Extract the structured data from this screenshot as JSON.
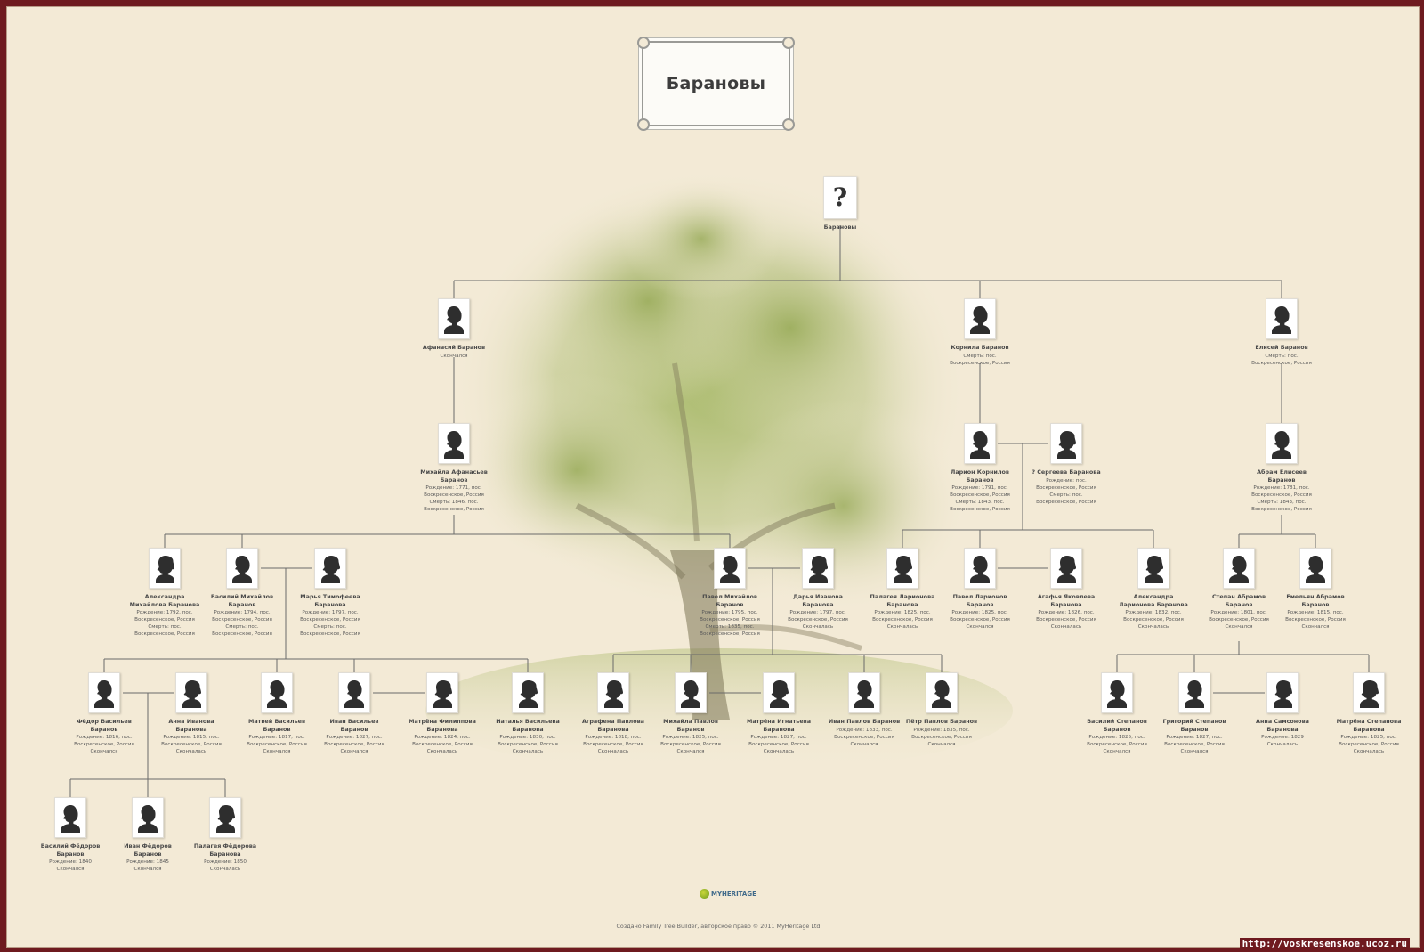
{
  "title": "Барановы",
  "footer": {
    "brand": "MYHERITAGE",
    "credit": "Создано Family Tree Builder, авторское право © 2011 MyHeritage Ltd."
  },
  "watermark_url": "http://voskresenskoe.ucoz.ru",
  "colors": {
    "frame": "#6e1a1f",
    "background": "#f3ead6",
    "line": "#6a6a6a",
    "tree": "#8aa248"
  },
  "people": [
    {
      "id": "root",
      "icon": "question-mark",
      "name": "Барановы",
      "info": ""
    },
    {
      "id": "afanasy",
      "icon": "male-silhouette-icon",
      "name": "Афанасий Баранов",
      "info": "Скончался"
    },
    {
      "id": "kornila",
      "icon": "male-silhouette-icon",
      "name": "Корнила Баранов",
      "info": "Смерть: пос.\nВоскресенское, Россия"
    },
    {
      "id": "eliseу",
      "icon": "male-silhouette-icon",
      "name": "Елисей Баранов",
      "info": "Смерть: пос.\nВоскресенское, Россия"
    },
    {
      "id": "mikhaila_af",
      "icon": "male-silhouette-icon",
      "name": "Михайла Афанасьев\nБаранов",
      "info": "Рождение: 1771, пос.\nВоскресенское, Россия\nСмерть: 1846, пос.\nВоскресенское, Россия"
    },
    {
      "id": "larion",
      "icon": "male-silhouette-icon",
      "name": "Ларион Корнилов\nБаранов",
      "info": "Рождение: 1791, пос.\nВоскресенское, Россия\nСмерть: 1843, пос.\nВоскресенское, Россия"
    },
    {
      "id": "sergeeva",
      "icon": "female-silhouette-icon",
      "name": "? Сергеева Баранова",
      "info": "Рождение: пос.\nВоскресенское, Россия\nСмерть: пос.\nВоскресенское, Россия"
    },
    {
      "id": "abram",
      "icon": "male-silhouette-icon",
      "name": "Абрам Елисеев\nБаранов",
      "info": "Рождение: 1781, пос.\nВоскресенское, Россия\nСмерть: 1843, пос.\nВоскресенское, Россия"
    },
    {
      "id": "aleksandra_m",
      "icon": "female-silhouette-icon",
      "name": "Александра\nМихайлова Баранова",
      "info": "Рождение: 1792, пос.\nВоскресенское, Россия\nСмерть: пос.\nВоскресенское, Россия"
    },
    {
      "id": "vasily_m",
      "icon": "male-silhouette-icon",
      "name": "Василий Михайлов\nБаранов",
      "info": "Рождение: 1794, пос.\nВоскресенское, Россия\nСмерть: пос.\nВоскресенское, Россия"
    },
    {
      "id": "marya",
      "icon": "female-silhouette-icon",
      "name": "Марья Тимофеева\nБаранова",
      "info": "Рождение: 1797, пос.\nВоскресенское, Россия\nСмерть: пос.\nВоскресенское, Россия"
    },
    {
      "id": "pavel_m",
      "icon": "male-silhouette-icon",
      "name": "Павел Михайлов\nБаранов",
      "info": "Рождение: 1795, пос.\nВоскресенское, Россия\nСмерть: 1835, пос.\nВоскресенское, Россия"
    },
    {
      "id": "darya",
      "icon": "female-silhouette-icon",
      "name": "Дарья Иванова\nБаранова",
      "info": "Рождение: 1797, пос.\nВоскресенское, Россия\nСкончалась"
    },
    {
      "id": "palageya_l",
      "icon": "female-silhouette-icon",
      "name": "Палагея Ларионова\nБаранова",
      "info": "Рождение: 1825, пос.\nВоскресенское, Россия\nСкончалась"
    },
    {
      "id": "pavel_l",
      "icon": "male-silhouette-icon",
      "name": "Павел Ларионов\nБаранов",
      "info": "Рождение: 1825, пос.\nВоскресенское, Россия\nСкончался"
    },
    {
      "id": "agafya",
      "icon": "female-silhouette-icon",
      "name": "Агафья Яковлева\nБаранова",
      "info": "Рождение: 1826, пос.\nВоскресенское, Россия\nСкончалась"
    },
    {
      "id": "aleksandra_l",
      "icon": "female-silhouette-icon",
      "name": "Александра\nЛарионова Баранова",
      "info": "Рождение: 1832, пос.\nВоскресенское, Россия\nСкончалась"
    },
    {
      "id": "stepan",
      "icon": "male-silhouette-icon",
      "name": "Степан Абрамов\nБаранов",
      "info": "Рождение: 1801, пос.\nВоскресенское, Россия\nСкончался"
    },
    {
      "id": "emelyan",
      "icon": "male-silhouette-icon",
      "name": "Емельян Абрамов\nБаранов",
      "info": "Рождение: 1815, пос.\nВоскресенское, Россия\nСкончался"
    },
    {
      "id": "fedor",
      "icon": "male-silhouette-icon",
      "name": "Фёдор Васильев\nБаранов",
      "info": "Рождение: 1816, пос.\nВоскресенское, Россия\nСкончался"
    },
    {
      "id": "anna_i",
      "icon": "female-silhouette-icon",
      "name": "Анна Иванова\nБаранова",
      "info": "Рождение: 1815, пос.\nВоскресенское, Россия\nСкончалась"
    },
    {
      "id": "matvey",
      "icon": "male-silhouette-icon",
      "name": "Матвей Васильев\nБаранов",
      "info": "Рождение: 1817, пос.\nВоскресенское, Россия\nСкончался"
    },
    {
      "id": "ivan_v",
      "icon": "male-silhouette-icon",
      "name": "Иван Васильев\nБаранов",
      "info": "Рождение: 1827, пос.\nВоскресенское, Россия\nСкончался"
    },
    {
      "id": "matrena_f",
      "icon": "female-silhouette-icon",
      "name": "Матрёна Филиппова\nБаранова",
      "info": "Рождение: 1824, пос.\nВоскресенское, Россия\nСкончалась"
    },
    {
      "id": "natalya",
      "icon": "female-silhouette-icon",
      "name": "Наталья Васильева\nБаранова",
      "info": "Рождение: 1830, пос.\nВоскресенское, Россия\nСкончалась"
    },
    {
      "id": "agrafena",
      "icon": "female-silhouette-icon",
      "name": "Аграфена Павлова\nБаранова",
      "info": "Рождение: 1818, пос.\nВоскресенское, Россия\nСкончалась"
    },
    {
      "id": "mikhaila_p",
      "icon": "male-silhouette-icon",
      "name": "Михайла Павлов\nБаранов",
      "info": "Рождение: 1825, пос.\nВоскресенское, Россия\nСкончался"
    },
    {
      "id": "matrena_ig",
      "icon": "female-silhouette-icon",
      "name": "Матрёна Игнатьева\nБаранова",
      "info": "Рождение: 1827, пос.\nВоскресенское, Россия\nСкончалась"
    },
    {
      "id": "ivan_p",
      "icon": "male-silhouette-icon",
      "name": "Иван Павлов Баранов",
      "info": "Рождение: 1833, пос.\nВоскресенское, Россия\nСкончался"
    },
    {
      "id": "petr",
      "icon": "male-silhouette-icon",
      "name": "Пётр Павлов Баранов",
      "info": "Рождение: 1835, пос.\nВоскресенское, Россия\nСкончался"
    },
    {
      "id": "vasily_s",
      "icon": "male-silhouette-icon",
      "name": "Василий Степанов\nБаранов",
      "info": "Рождение: 1825, пос.\nВоскресенское, Россия\nСкончался"
    },
    {
      "id": "grigory",
      "icon": "male-silhouette-icon",
      "name": "Григорий Степанов\nБаранов",
      "info": "Рождение: 1827, пос.\nВоскресенское, Россия\nСкончался"
    },
    {
      "id": "anna_s",
      "icon": "female-silhouette-icon",
      "name": "Анна Самсонова\nБаранова",
      "info": "Рождение: 1829\nСкончалась"
    },
    {
      "id": "matrena_st",
      "icon": "female-silhouette-icon",
      "name": "Матрёна Степанова\nБаранова",
      "info": "Рождение: 1825, пос.\nВоскресенское, Россия\nСкончалась"
    },
    {
      "id": "vasily_f",
      "icon": "male-silhouette-icon",
      "name": "Василий Фёдоров\nБаранов",
      "info": "Рождение: 1840\nСкончался"
    },
    {
      "id": "ivan_f",
      "icon": "male-silhouette-icon",
      "name": "Иван Фёдоров\nБаранов",
      "info": "Рождение: 1845\nСкончался"
    },
    {
      "id": "palageya_f",
      "icon": "female-silhouette-icon",
      "name": "Палагея Фёдорова\nБаранова",
      "info": "Рождение: 1850\nСкончалась"
    }
  ]
}
